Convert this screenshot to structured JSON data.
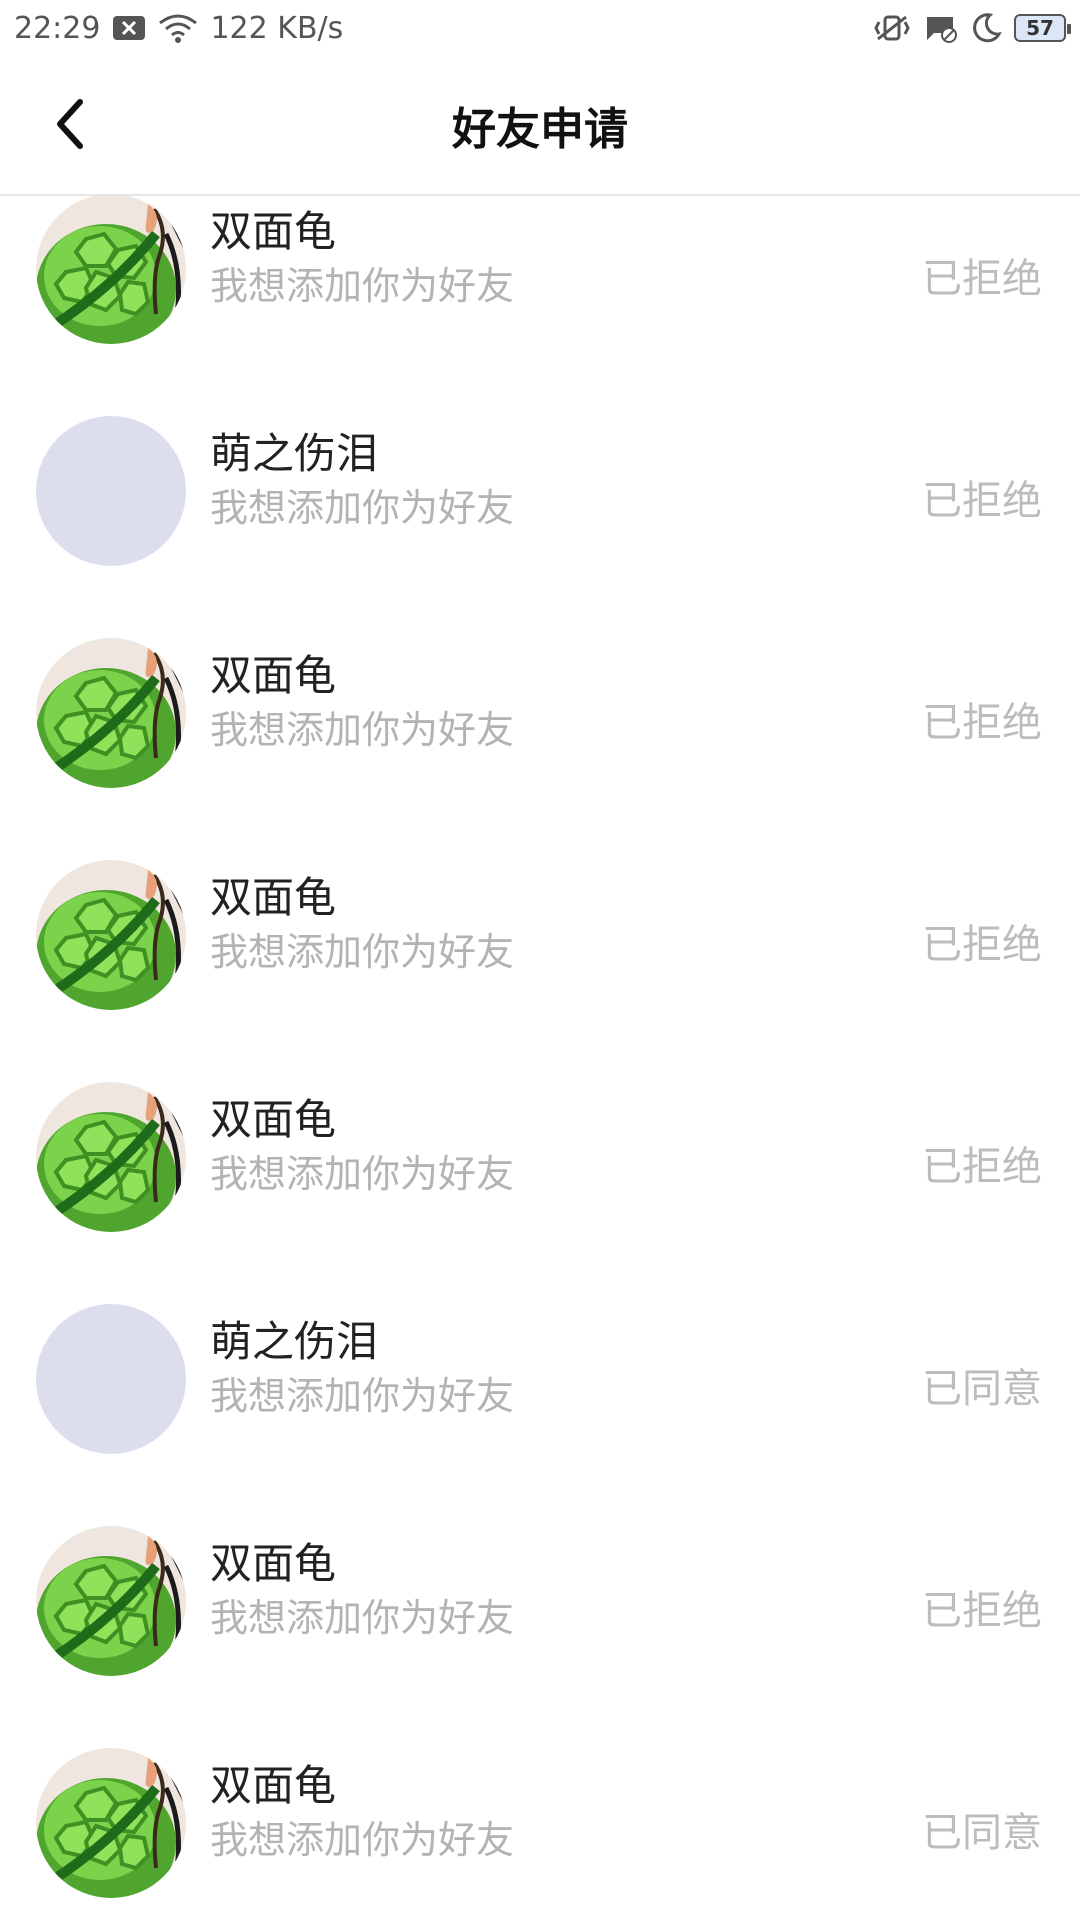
{
  "status_bar": {
    "time": "22:29",
    "net_speed": "122 KB/s",
    "battery": "57",
    "icons": [
      "close-box-icon",
      "wifi-icon",
      "vibrate-icon",
      "message-blocked-icon",
      "moon-icon",
      "battery-icon"
    ]
  },
  "header": {
    "title": "好友申请",
    "back_icon": "chevron-left-icon"
  },
  "requests": [
    {
      "name": "双面龟",
      "message": "我想添加你为好友",
      "status": "已拒绝",
      "avatar": "turtle"
    },
    {
      "name": "萌之伤泪",
      "message": "我想添加你为好友",
      "status": "已拒绝",
      "avatar": "blank"
    },
    {
      "name": "双面龟",
      "message": "我想添加你为好友",
      "status": "已拒绝",
      "avatar": "turtle"
    },
    {
      "name": "双面龟",
      "message": "我想添加你为好友",
      "status": "已拒绝",
      "avatar": "turtle"
    },
    {
      "name": "双面龟",
      "message": "我想添加你为好友",
      "status": "已拒绝",
      "avatar": "turtle"
    },
    {
      "name": "萌之伤泪",
      "message": "我想添加你为好友",
      "status": "已同意",
      "avatar": "blank"
    },
    {
      "name": "双面龟",
      "message": "我想添加你为好友",
      "status": "已拒绝",
      "avatar": "turtle"
    },
    {
      "name": "双面龟",
      "message": "我想添加你为好友",
      "status": "已同意",
      "avatar": "turtle"
    }
  ],
  "colors": {
    "blank_avatar": "#dcdeee",
    "turtle_green": "#5cbf3a",
    "status_text": "#bcbcbc",
    "message_text": "#b3b3b3"
  }
}
